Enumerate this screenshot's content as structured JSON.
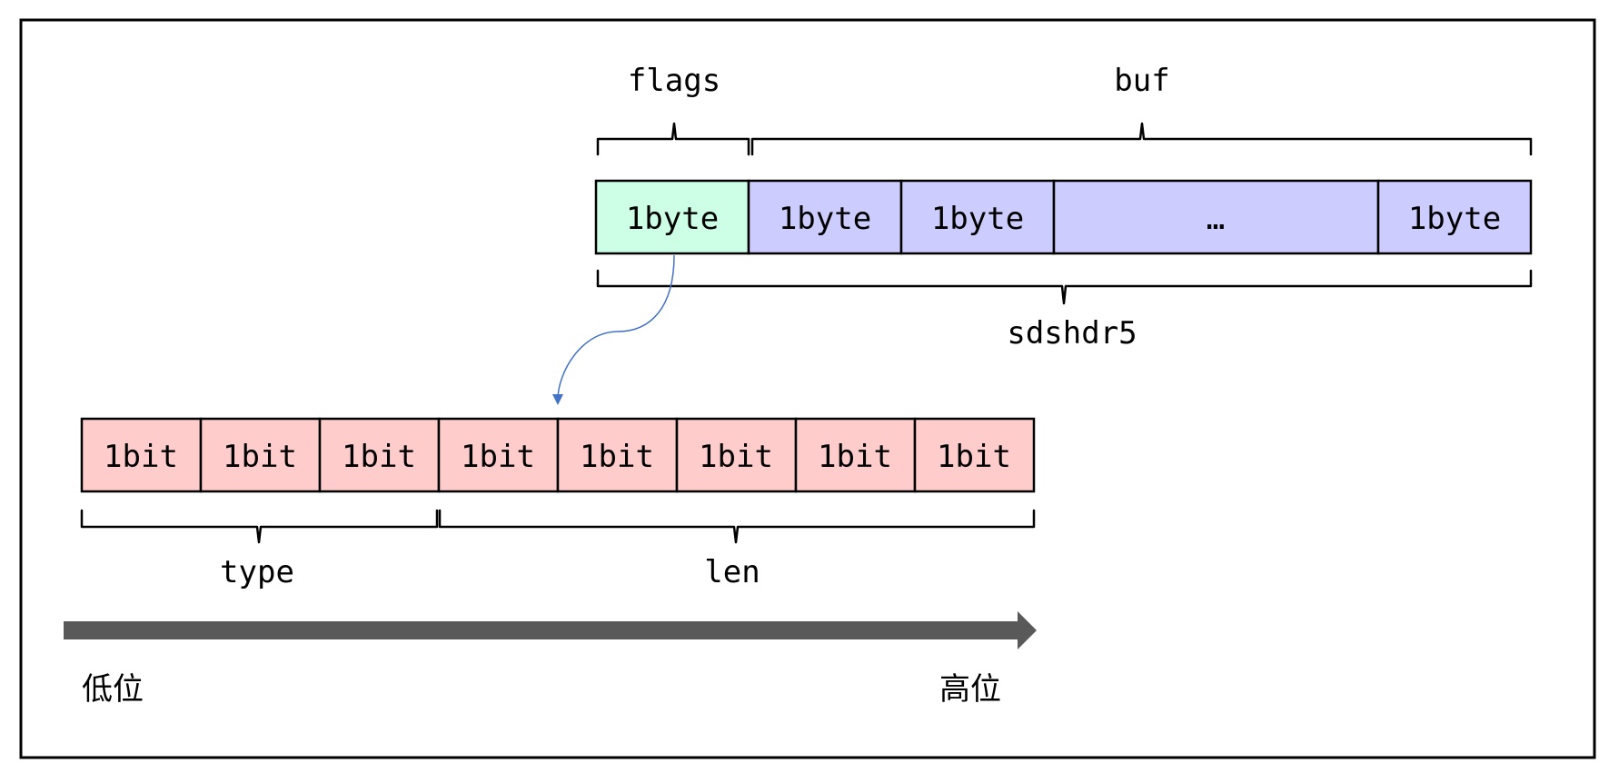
{
  "colors": {
    "flags_cell": "#ccffe6",
    "buf_cell": "#ccccff",
    "bit_cell": "#ffcccc",
    "arrow": "#595959",
    "connector": "#4472c4",
    "border": "#000000"
  },
  "header_row": {
    "cells": [
      "1byte",
      "1byte",
      "1byte",
      "…",
      "1byte"
    ],
    "flags_label": "flags",
    "buf_label": "buf",
    "struct_label": "sdshdr5"
  },
  "bit_row": {
    "cells": [
      "1bit",
      "1bit",
      "1bit",
      "1bit",
      "1bit",
      "1bit",
      "1bit",
      "1bit"
    ],
    "type_label": "type",
    "len_label": "len"
  },
  "axis": {
    "low_label": "低位",
    "high_label": "高位"
  }
}
